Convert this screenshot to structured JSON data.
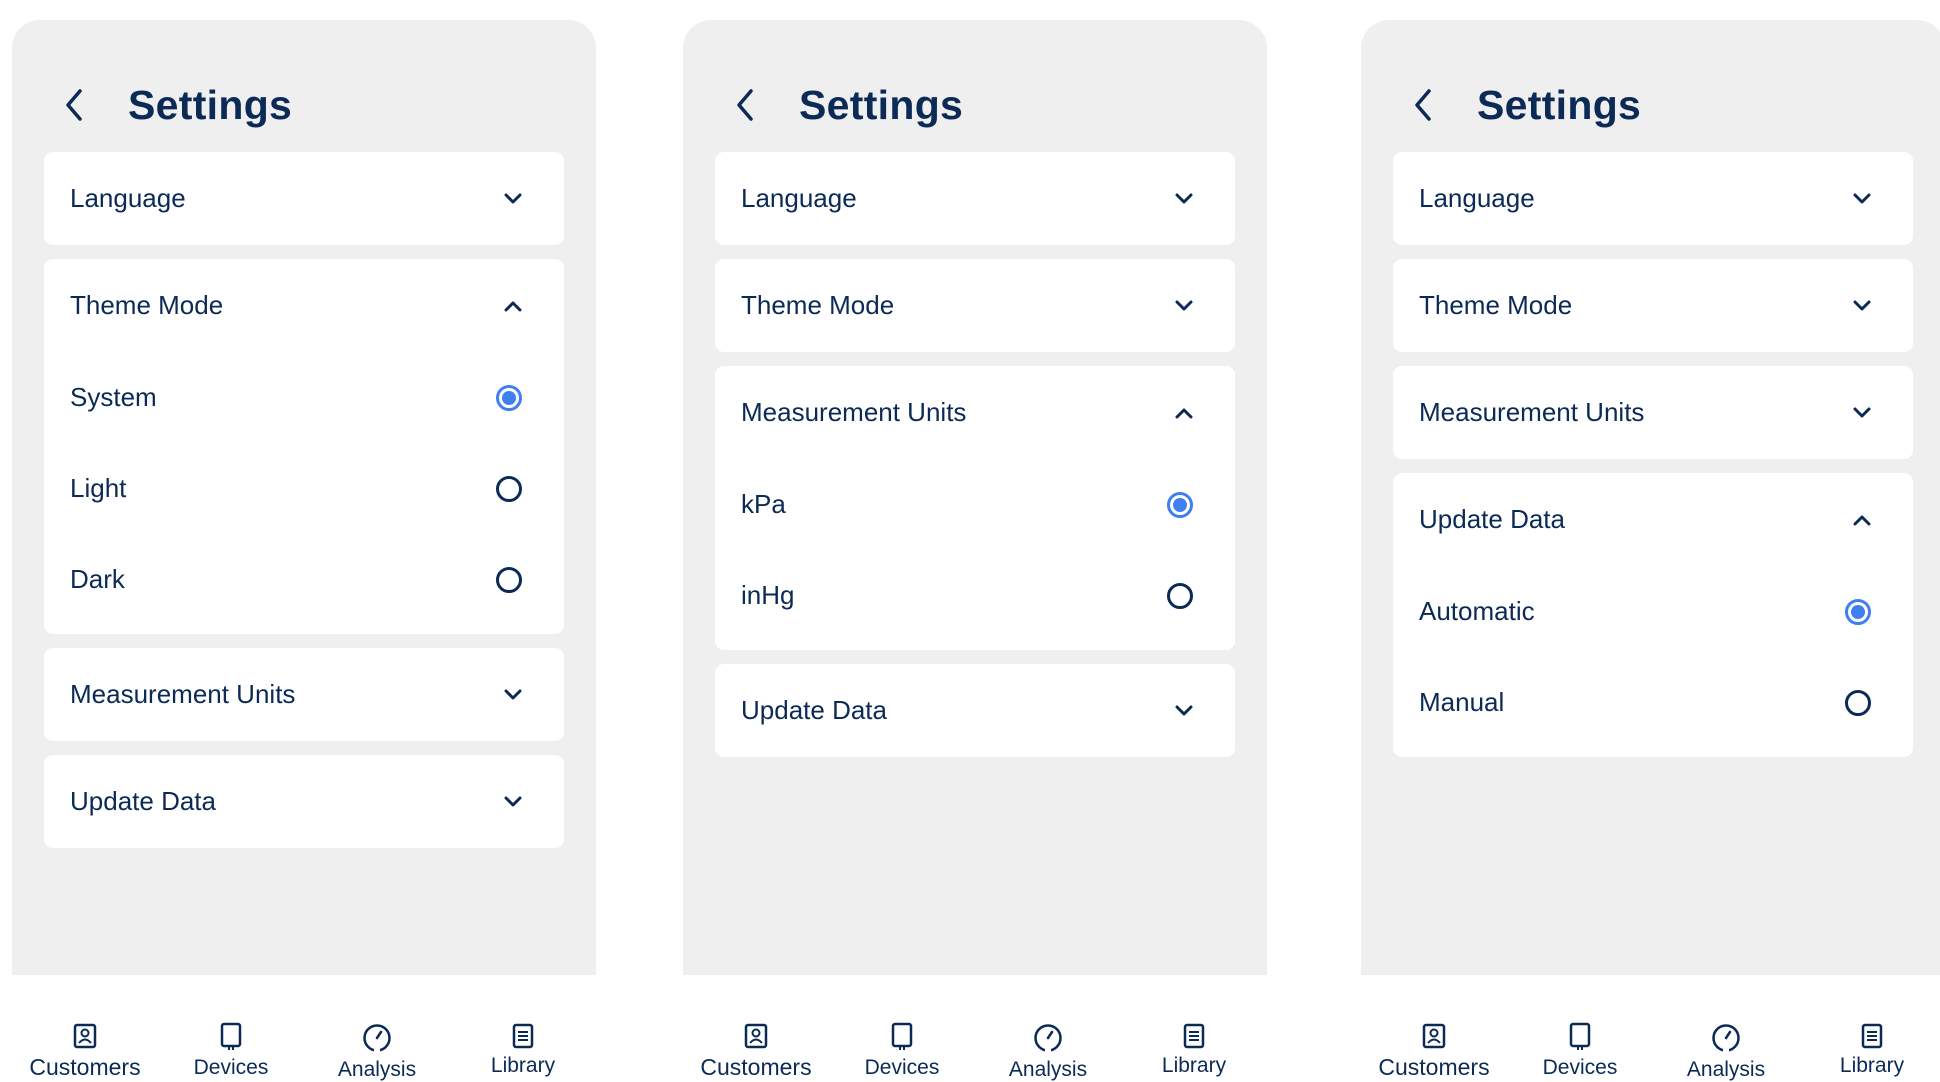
{
  "colors": {
    "accent": "#3f7ff2",
    "text": "#0b2a55",
    "panel_bg": "#efefef",
    "card_bg": "#ffffff"
  },
  "screens": [
    {
      "title": "Settings",
      "back_icon": "chevron-left-icon",
      "sections": [
        {
          "label": "Language",
          "expanded": false
        },
        {
          "label": "Theme Mode",
          "expanded": true,
          "options": [
            {
              "label": "System",
              "selected": true
            },
            {
              "label": "Light",
              "selected": false
            },
            {
              "label": "Dark",
              "selected": false
            }
          ]
        },
        {
          "label": "Measurement Units",
          "expanded": false
        },
        {
          "label": "Update Data",
          "expanded": false
        }
      ],
      "tabs": [
        {
          "label": "Customers",
          "icon": "contact-book-icon",
          "active": true
        },
        {
          "label": "Devices",
          "icon": "device-icon",
          "active": false
        },
        {
          "label": "Analysis",
          "icon": "gauge-icon",
          "active": false
        },
        {
          "label": "Library",
          "icon": "document-icon",
          "active": false
        }
      ]
    },
    {
      "title": "Settings",
      "back_icon": "chevron-left-icon",
      "sections": [
        {
          "label": "Language",
          "expanded": false
        },
        {
          "label": "Theme Mode",
          "expanded": false
        },
        {
          "label": "Measurement Units",
          "expanded": true,
          "options": [
            {
              "label": "kPa",
              "selected": true
            },
            {
              "label": "inHg",
              "selected": false
            }
          ]
        },
        {
          "label": "Update Data",
          "expanded": false
        }
      ],
      "tabs": [
        {
          "label": "Customers",
          "icon": "contact-book-icon",
          "active": true
        },
        {
          "label": "Devices",
          "icon": "device-icon",
          "active": false
        },
        {
          "label": "Analysis",
          "icon": "gauge-icon",
          "active": false
        },
        {
          "label": "Library",
          "icon": "document-icon",
          "active": false
        }
      ]
    },
    {
      "title": "Settings",
      "back_icon": "chevron-left-icon",
      "sections": [
        {
          "label": "Language",
          "expanded": false
        },
        {
          "label": "Theme Mode",
          "expanded": false
        },
        {
          "label": "Measurement Units",
          "expanded": false
        },
        {
          "label": "Update Data",
          "expanded": true,
          "options": [
            {
              "label": "Automatic",
              "selected": true
            },
            {
              "label": "Manual",
              "selected": false
            }
          ]
        }
      ],
      "tabs": [
        {
          "label": "Customers",
          "icon": "contact-book-icon",
          "active": true
        },
        {
          "label": "Devices",
          "icon": "device-icon",
          "active": false
        },
        {
          "label": "Analysis",
          "icon": "gauge-icon",
          "active": false
        },
        {
          "label": "Library",
          "icon": "document-icon",
          "active": false
        }
      ]
    }
  ]
}
